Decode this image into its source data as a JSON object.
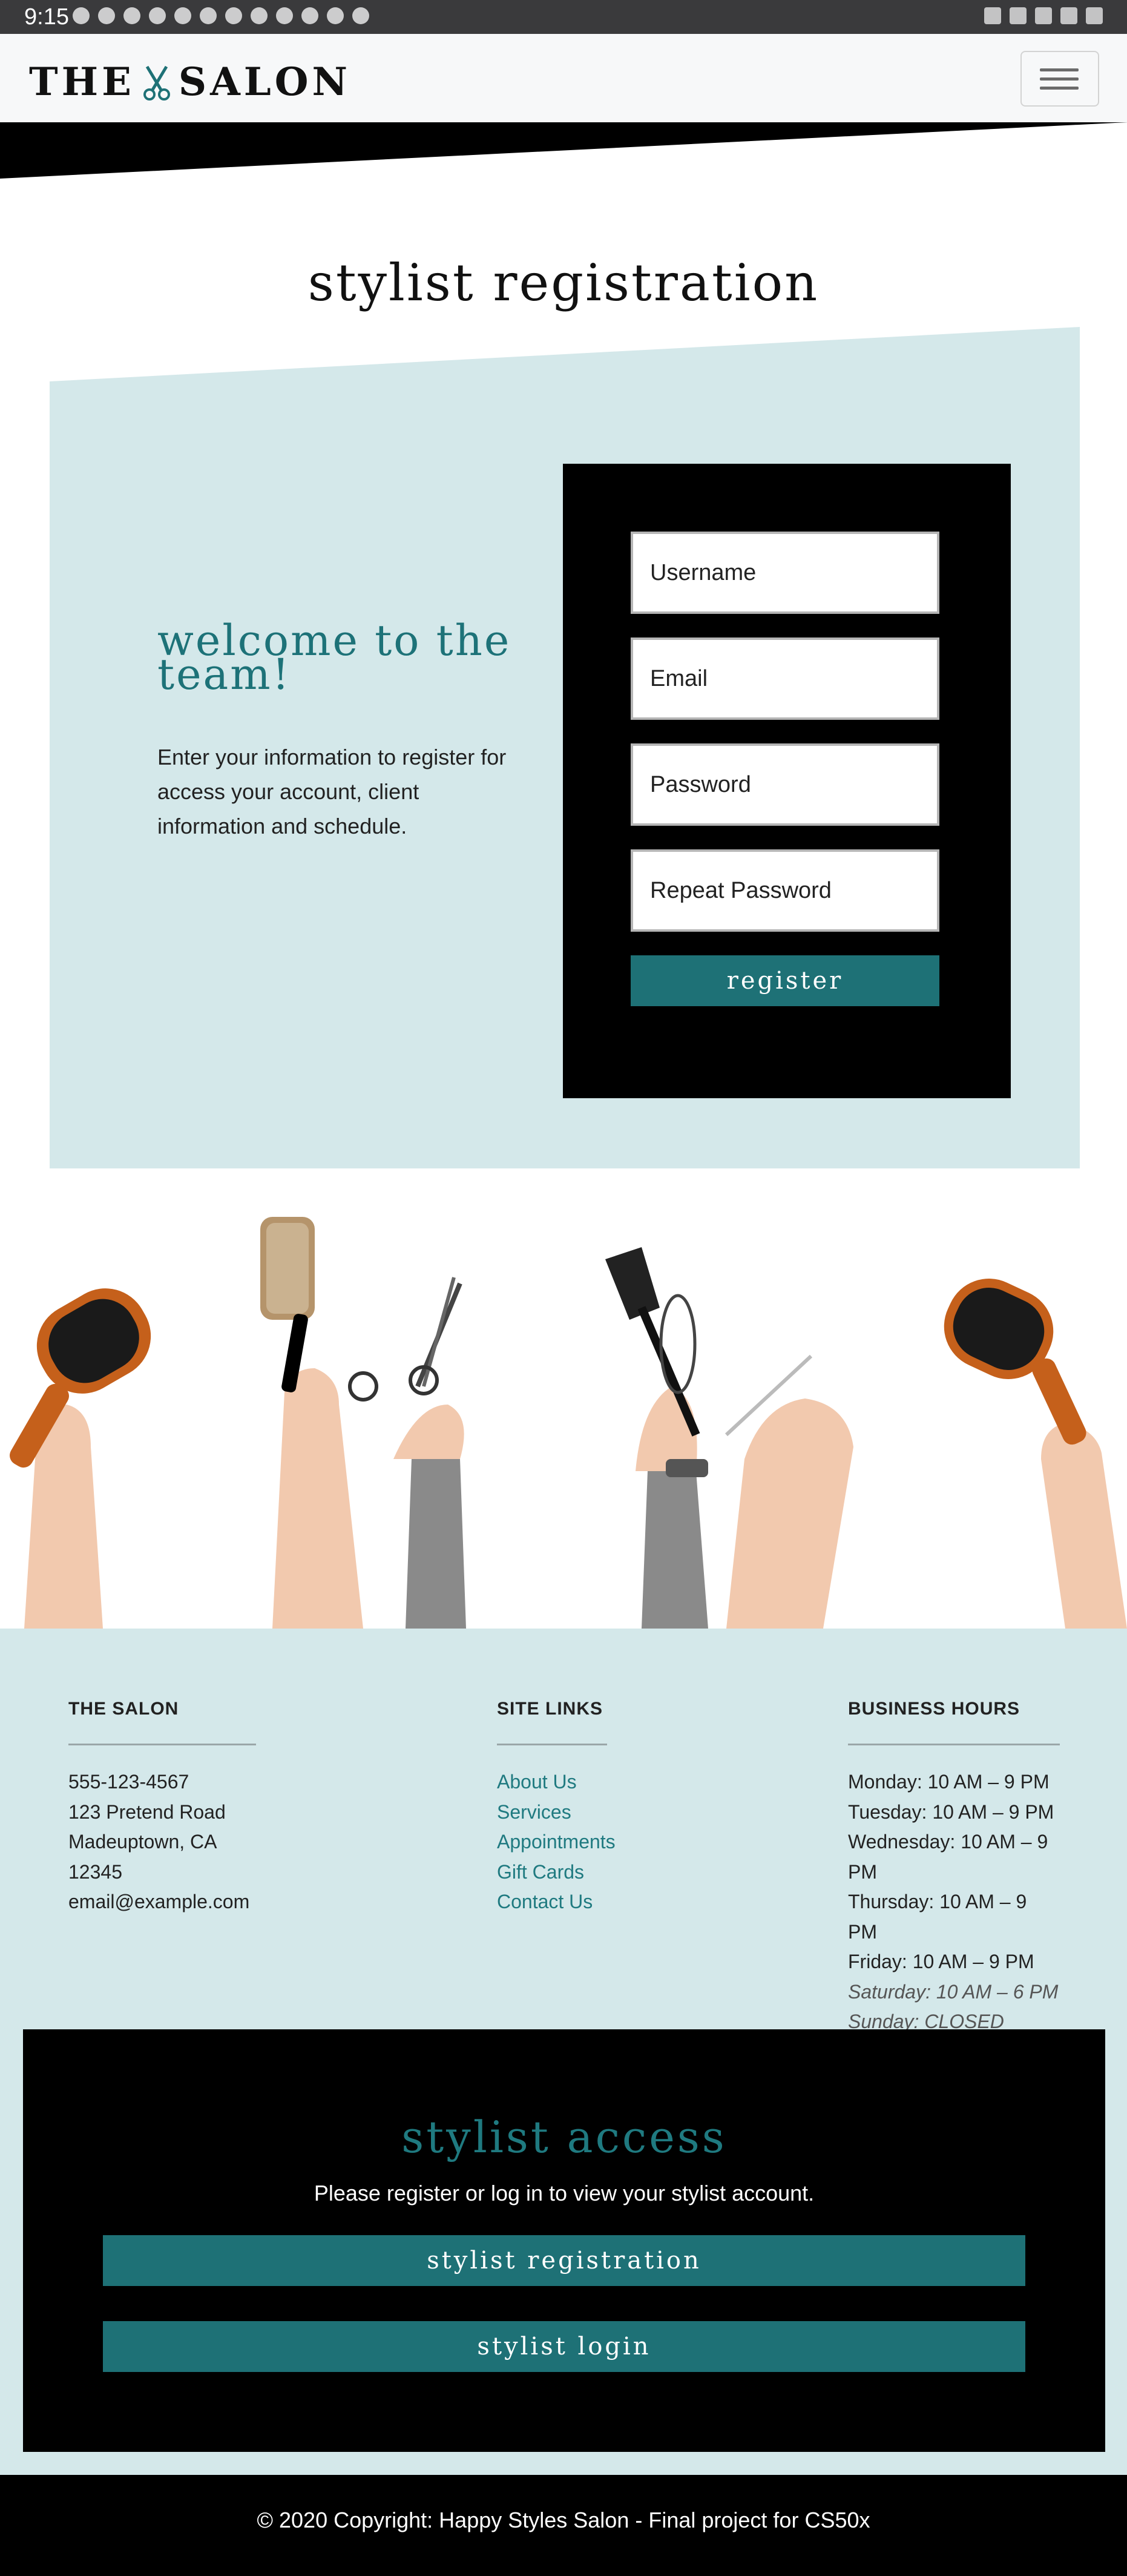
{
  "status_bar": {
    "time": "9:15"
  },
  "navbar": {
    "brand_left": "THE",
    "brand_right": "SALON",
    "menu_icon": "hamburger-icon"
  },
  "page_title": "stylist registration",
  "welcome": {
    "heading": "welcome to the team!",
    "text": "Enter your information to register for access your account, client information and schedule."
  },
  "form": {
    "username_placeholder": "Username",
    "email_placeholder": "Email",
    "password_placeholder": "Password",
    "repeat_password_placeholder": "Repeat Password",
    "register_label": "register"
  },
  "footer": {
    "about": {
      "heading": "THE SALON",
      "phone": "555-123-4567",
      "street": "123 Pretend Road",
      "city": "Madeuptown, CA 12345",
      "email": "email@example.com"
    },
    "links": {
      "heading": "SITE LINKS",
      "items": [
        "About Us",
        "Services",
        "Appointments",
        "Gift Cards",
        "Contact Us"
      ]
    },
    "hours": {
      "heading": "BUSINESS HOURS",
      "monday": "Monday: 10 AM – 9 PM",
      "tuesday": "Tuesday: 10 AM – 9 PM",
      "wednesday": "Wednesday: 10 AM – 9 PM",
      "thursday": "Thursday: 10 AM – 9 PM",
      "friday": "Friday: 10 AM – 9 PM",
      "saturday": "Saturday: 10 AM – 6 PM",
      "sunday": "Sunday: CLOSED"
    }
  },
  "stylist_access": {
    "title": "stylist access",
    "text": "Please register or log in to view your stylist account.",
    "registration_label": "stylist registration",
    "login_label": "stylist login"
  },
  "copyright": "© 2020 Copyright: Happy Styles Salon - Final project for CS50x",
  "colors": {
    "teal": "#1e7176",
    "light_teal": "#d4e8ea",
    "black": "#000000"
  }
}
